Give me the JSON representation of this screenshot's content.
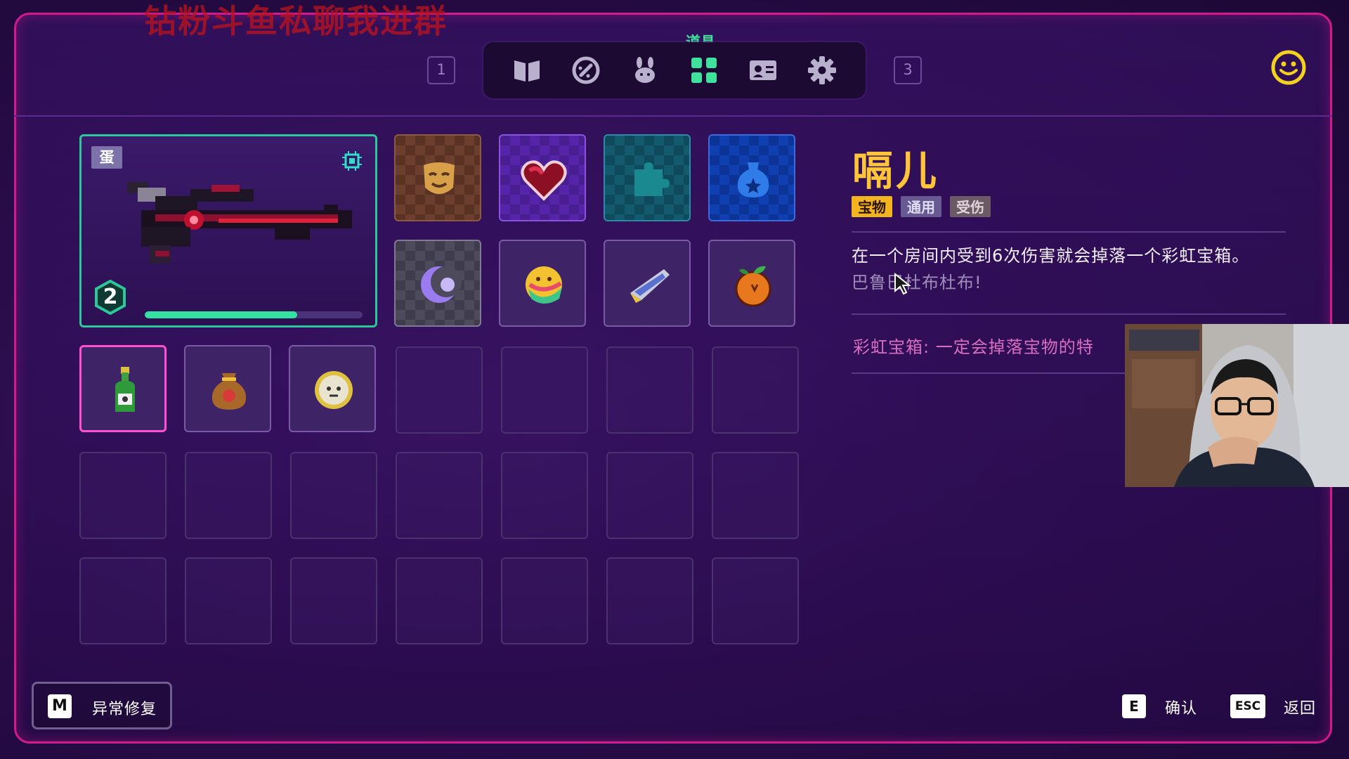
{
  "watermark": "钻粉斗鱼私聊我进群",
  "nav": {
    "prev_key": "1",
    "next_key": "3",
    "active_tab_label": "道具",
    "tabs": [
      {
        "icon": "book-icon"
      },
      {
        "icon": "gauge-icon"
      },
      {
        "icon": "pet-icon"
      },
      {
        "icon": "grid-icon"
      },
      {
        "icon": "id-card-icon"
      },
      {
        "icon": "gear-icon"
      }
    ]
  },
  "weapon": {
    "badge": "蛋",
    "level": "2",
    "xp_fraction": 0.7,
    "icon": "dark-red-rifle-icon"
  },
  "inventory": {
    "row1": [
      "mask-icon",
      "heart-icon",
      "puzzle-icon",
      "pouch-icon"
    ],
    "row2": [
      "crescent-icon",
      "rainbow-fruit-icon",
      "sharp-blade-icon",
      "orange-icon"
    ],
    "row3": [
      "bottle-icon",
      "coin-bag-icon",
      "coin-face-icon"
    ]
  },
  "detail": {
    "name": "嗝儿",
    "tags": [
      "宝物",
      "通用",
      "受伤"
    ],
    "description": "在一个房间内受到6次伤害就会掉落一个彩虹宝箱。",
    "description_dim": "巴鲁巴杜布杜布!",
    "extra": "彩虹宝箱: 一定会掉落宝物的特"
  },
  "footer": {
    "repair_key": "M",
    "repair_label": "异常修复",
    "confirm_key": "E",
    "confirm_label": "确认",
    "back_key": "ESC",
    "back_label": "返回"
  },
  "colors": {
    "frame_border": "#d21a8c",
    "active_tab": "#3fe29d",
    "item_name": "#ffc53a",
    "selected_slot": "#ff4fd3",
    "weapon_border": "#2cc79b"
  }
}
